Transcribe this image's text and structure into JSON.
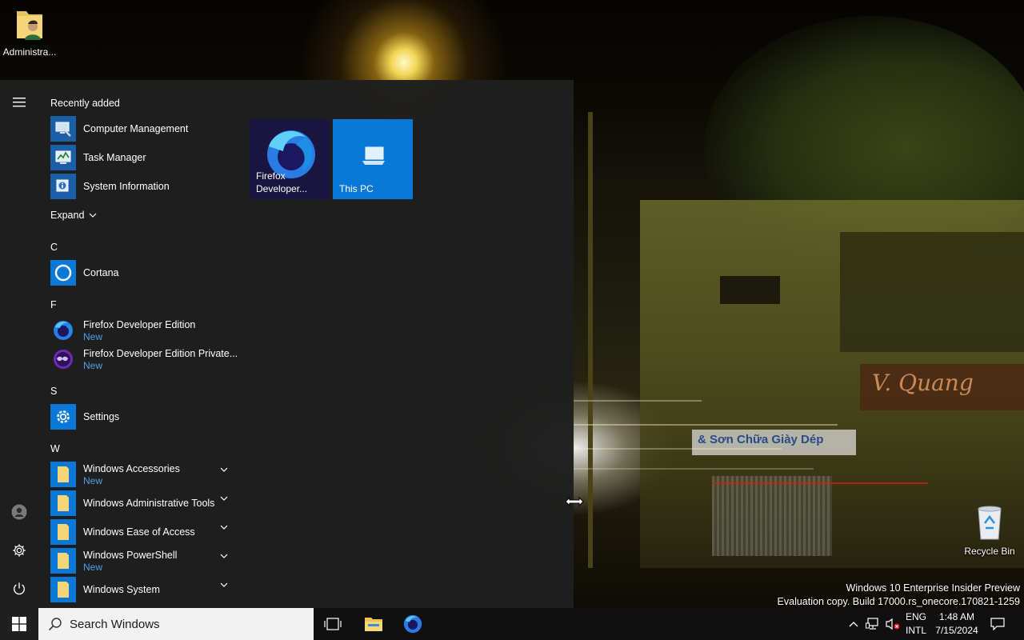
{
  "desktop": {
    "admin_icon_label": "Administra...",
    "recycle_bin_label": "Recycle Bin",
    "wallpaper_sign_text": "V. Quang",
    "wallpaper_banner_text": "& Sơn Chữa Giày Dép"
  },
  "start_menu": {
    "recently_added_label": "Recently added",
    "recent_apps": [
      {
        "name": "Computer Management",
        "icon": "computer-management-icon"
      },
      {
        "name": "Task Manager",
        "icon": "task-manager-icon"
      },
      {
        "name": "System Information",
        "icon": "system-information-icon"
      }
    ],
    "expand_label": "Expand",
    "sections": {
      "c": "C",
      "f": "F",
      "s": "S",
      "w": "W"
    },
    "apps": {
      "cortana": {
        "name": "Cortana"
      },
      "firefox_dev": {
        "name": "Firefox Developer Edition",
        "badge": "New"
      },
      "firefox_private": {
        "name": "Firefox Developer Edition Private...",
        "badge": "New"
      },
      "settings": {
        "name": "Settings"
      },
      "win_accessories": {
        "name": "Windows Accessories",
        "badge": "New"
      },
      "win_admin_tools": {
        "name": "Windows Administrative Tools"
      },
      "win_ease": {
        "name": "Windows Ease of Access"
      },
      "win_powershell": {
        "name": "Windows PowerShell",
        "badge": "New"
      },
      "win_system": {
        "name": "Windows System"
      }
    },
    "tiles": {
      "firefox_line1": "Firefox",
      "firefox_line2": "Developer...",
      "thispc": "This PC"
    }
  },
  "watermark": {
    "line1": "Windows 10 Enterprise Insider Preview",
    "line2": "Evaluation copy. Build 17000.rs_onecore.170821-1259"
  },
  "taskbar": {
    "search_placeholder": "Search Windows",
    "lang_line1": "ENG",
    "lang_line2": "INTL",
    "time": "1:48 AM",
    "date": "7/15/2024"
  },
  "colors": {
    "start_bg": "#1f1f1f",
    "accent": "#0a78d7",
    "new_badge": "#4aa3e8",
    "taskbar_bg": "#101010"
  }
}
